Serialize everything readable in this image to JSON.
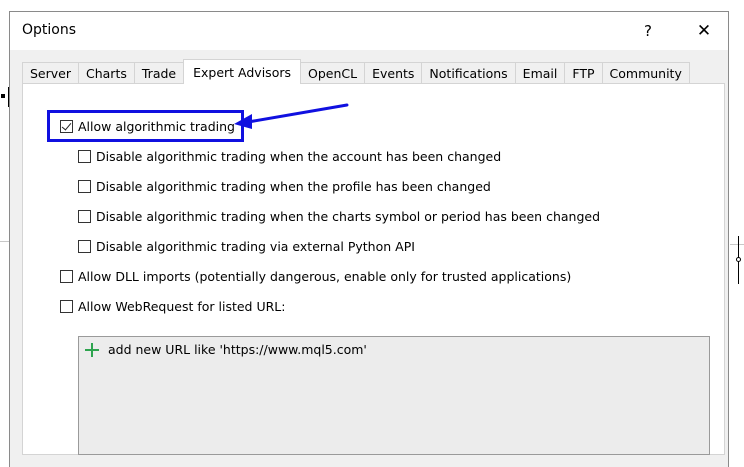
{
  "window": {
    "title": "Options",
    "help_label": "?",
    "close_label": "✕"
  },
  "tabs": [
    {
      "label": "Server",
      "active": false
    },
    {
      "label": "Charts",
      "active": false
    },
    {
      "label": "Trade",
      "active": false
    },
    {
      "label": "Expert Advisors",
      "active": true
    },
    {
      "label": "OpenCL",
      "active": false
    },
    {
      "label": "Events",
      "active": false
    },
    {
      "label": "Notifications",
      "active": false
    },
    {
      "label": "Email",
      "active": false
    },
    {
      "label": "FTP",
      "active": false
    },
    {
      "label": "Community",
      "active": false
    }
  ],
  "options": {
    "allow_algo": {
      "label": "Allow algorithmic trading",
      "checked": true
    },
    "disable_account": {
      "label": "Disable algorithmic trading when the account has been changed",
      "checked": false
    },
    "disable_profile": {
      "label": "Disable algorithmic trading when the profile has been changed",
      "checked": false
    },
    "disable_symbol": {
      "label": "Disable algorithmic trading when the charts symbol or period has been changed",
      "checked": false
    },
    "disable_python": {
      "label": "Disable algorithmic trading via external Python API",
      "checked": false
    },
    "allow_dll": {
      "label": "Allow DLL imports (potentially dangerous, enable only for trusted applications)",
      "checked": false
    },
    "allow_webrequest": {
      "label": "Allow WebRequest for listed URL:",
      "checked": false
    }
  },
  "url_list": {
    "add_label": "add new URL like 'https://www.mql5.com'",
    "add_icon": "plus-icon"
  },
  "annotation": {
    "color": "#1010e0"
  }
}
